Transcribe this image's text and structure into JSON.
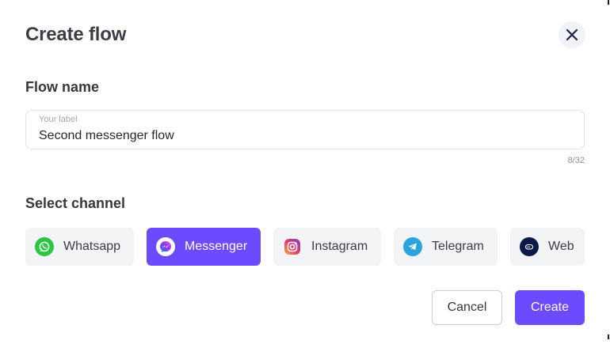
{
  "dialog": {
    "title": "Create flow",
    "close_icon": "close-icon"
  },
  "flow_name": {
    "section_label": "Flow name",
    "placeholder": "Your label",
    "value": "Second messenger flow",
    "counter": "8/32"
  },
  "channels": {
    "section_label": "Select channel",
    "selected": "Messenger",
    "items": [
      {
        "label": "Whatsapp",
        "icon": "whatsapp-icon",
        "color": "#25d366"
      },
      {
        "label": "Messenger",
        "icon": "messenger-icon",
        "color": "#6c4bff"
      },
      {
        "label": "Instagram",
        "icon": "instagram-icon",
        "color": "#e1306c"
      },
      {
        "label": "Telegram",
        "icon": "telegram-icon",
        "color": "#2aa3df"
      },
      {
        "label": "Web",
        "icon": "web-chat-icon",
        "color": "#0b1a4a"
      }
    ]
  },
  "actions": {
    "cancel_label": "Cancel",
    "create_label": "Create"
  },
  "colors": {
    "accent": "#6c4bff",
    "text": "#3b3e45",
    "chip_bg": "#f3f4f6"
  }
}
